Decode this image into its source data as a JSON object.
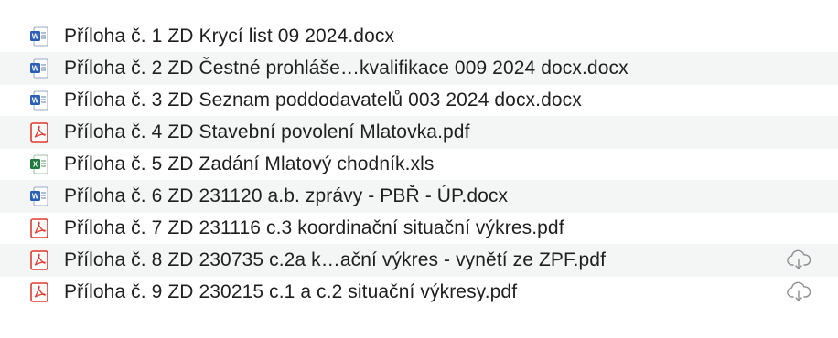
{
  "colors": {
    "stripe": "#f4f5f5",
    "word": "#2b5fb7",
    "pdf": "#e03a2f",
    "excel": "#1f7a3f",
    "cloud": "#8e8e93"
  },
  "files": [
    {
      "name": "Příloha č. 1 ZD Krycí list 09 2024.docx",
      "icon": "word-doc-icon",
      "cloud": false
    },
    {
      "name": "Příloha č. 2 ZD Čestné prohláše…kvalifikace  009 2024 docx.docx",
      "icon": "word-doc-icon",
      "cloud": false
    },
    {
      "name": "Příloha č. 3 ZD Seznam poddodavatelů  003 2024 docx.docx",
      "icon": "word-doc-icon",
      "cloud": false
    },
    {
      "name": "Příloha č. 4 ZD Stavební povolení Mlatovka.pdf",
      "icon": "pdf-icon",
      "cloud": false
    },
    {
      "name": "Příloha č. 5 ZD Zadání Mlatový chodník.xls",
      "icon": "excel-sheet-icon",
      "cloud": false
    },
    {
      "name": "Příloha č. 6 ZD 231120 a.b. zprávy - PBŘ - ÚP.docx",
      "icon": "word-doc-icon",
      "cloud": false
    },
    {
      "name": "Příloha č. 7 ZD 231116 c.3 koordinační situační výkres.pdf",
      "icon": "pdf-icon",
      "cloud": true
    },
    {
      "name": "Příloha č. 8 ZD 230735 c.2a k…ační výkres - vynětí ze ZPF.pdf",
      "icon": "pdf-icon",
      "cloud": true
    },
    {
      "name": "Příloha č. 9 ZD 230215 c.1 a c.2 situační výkresy.pdf",
      "icon": "pdf-icon",
      "cloud": true
    }
  ]
}
